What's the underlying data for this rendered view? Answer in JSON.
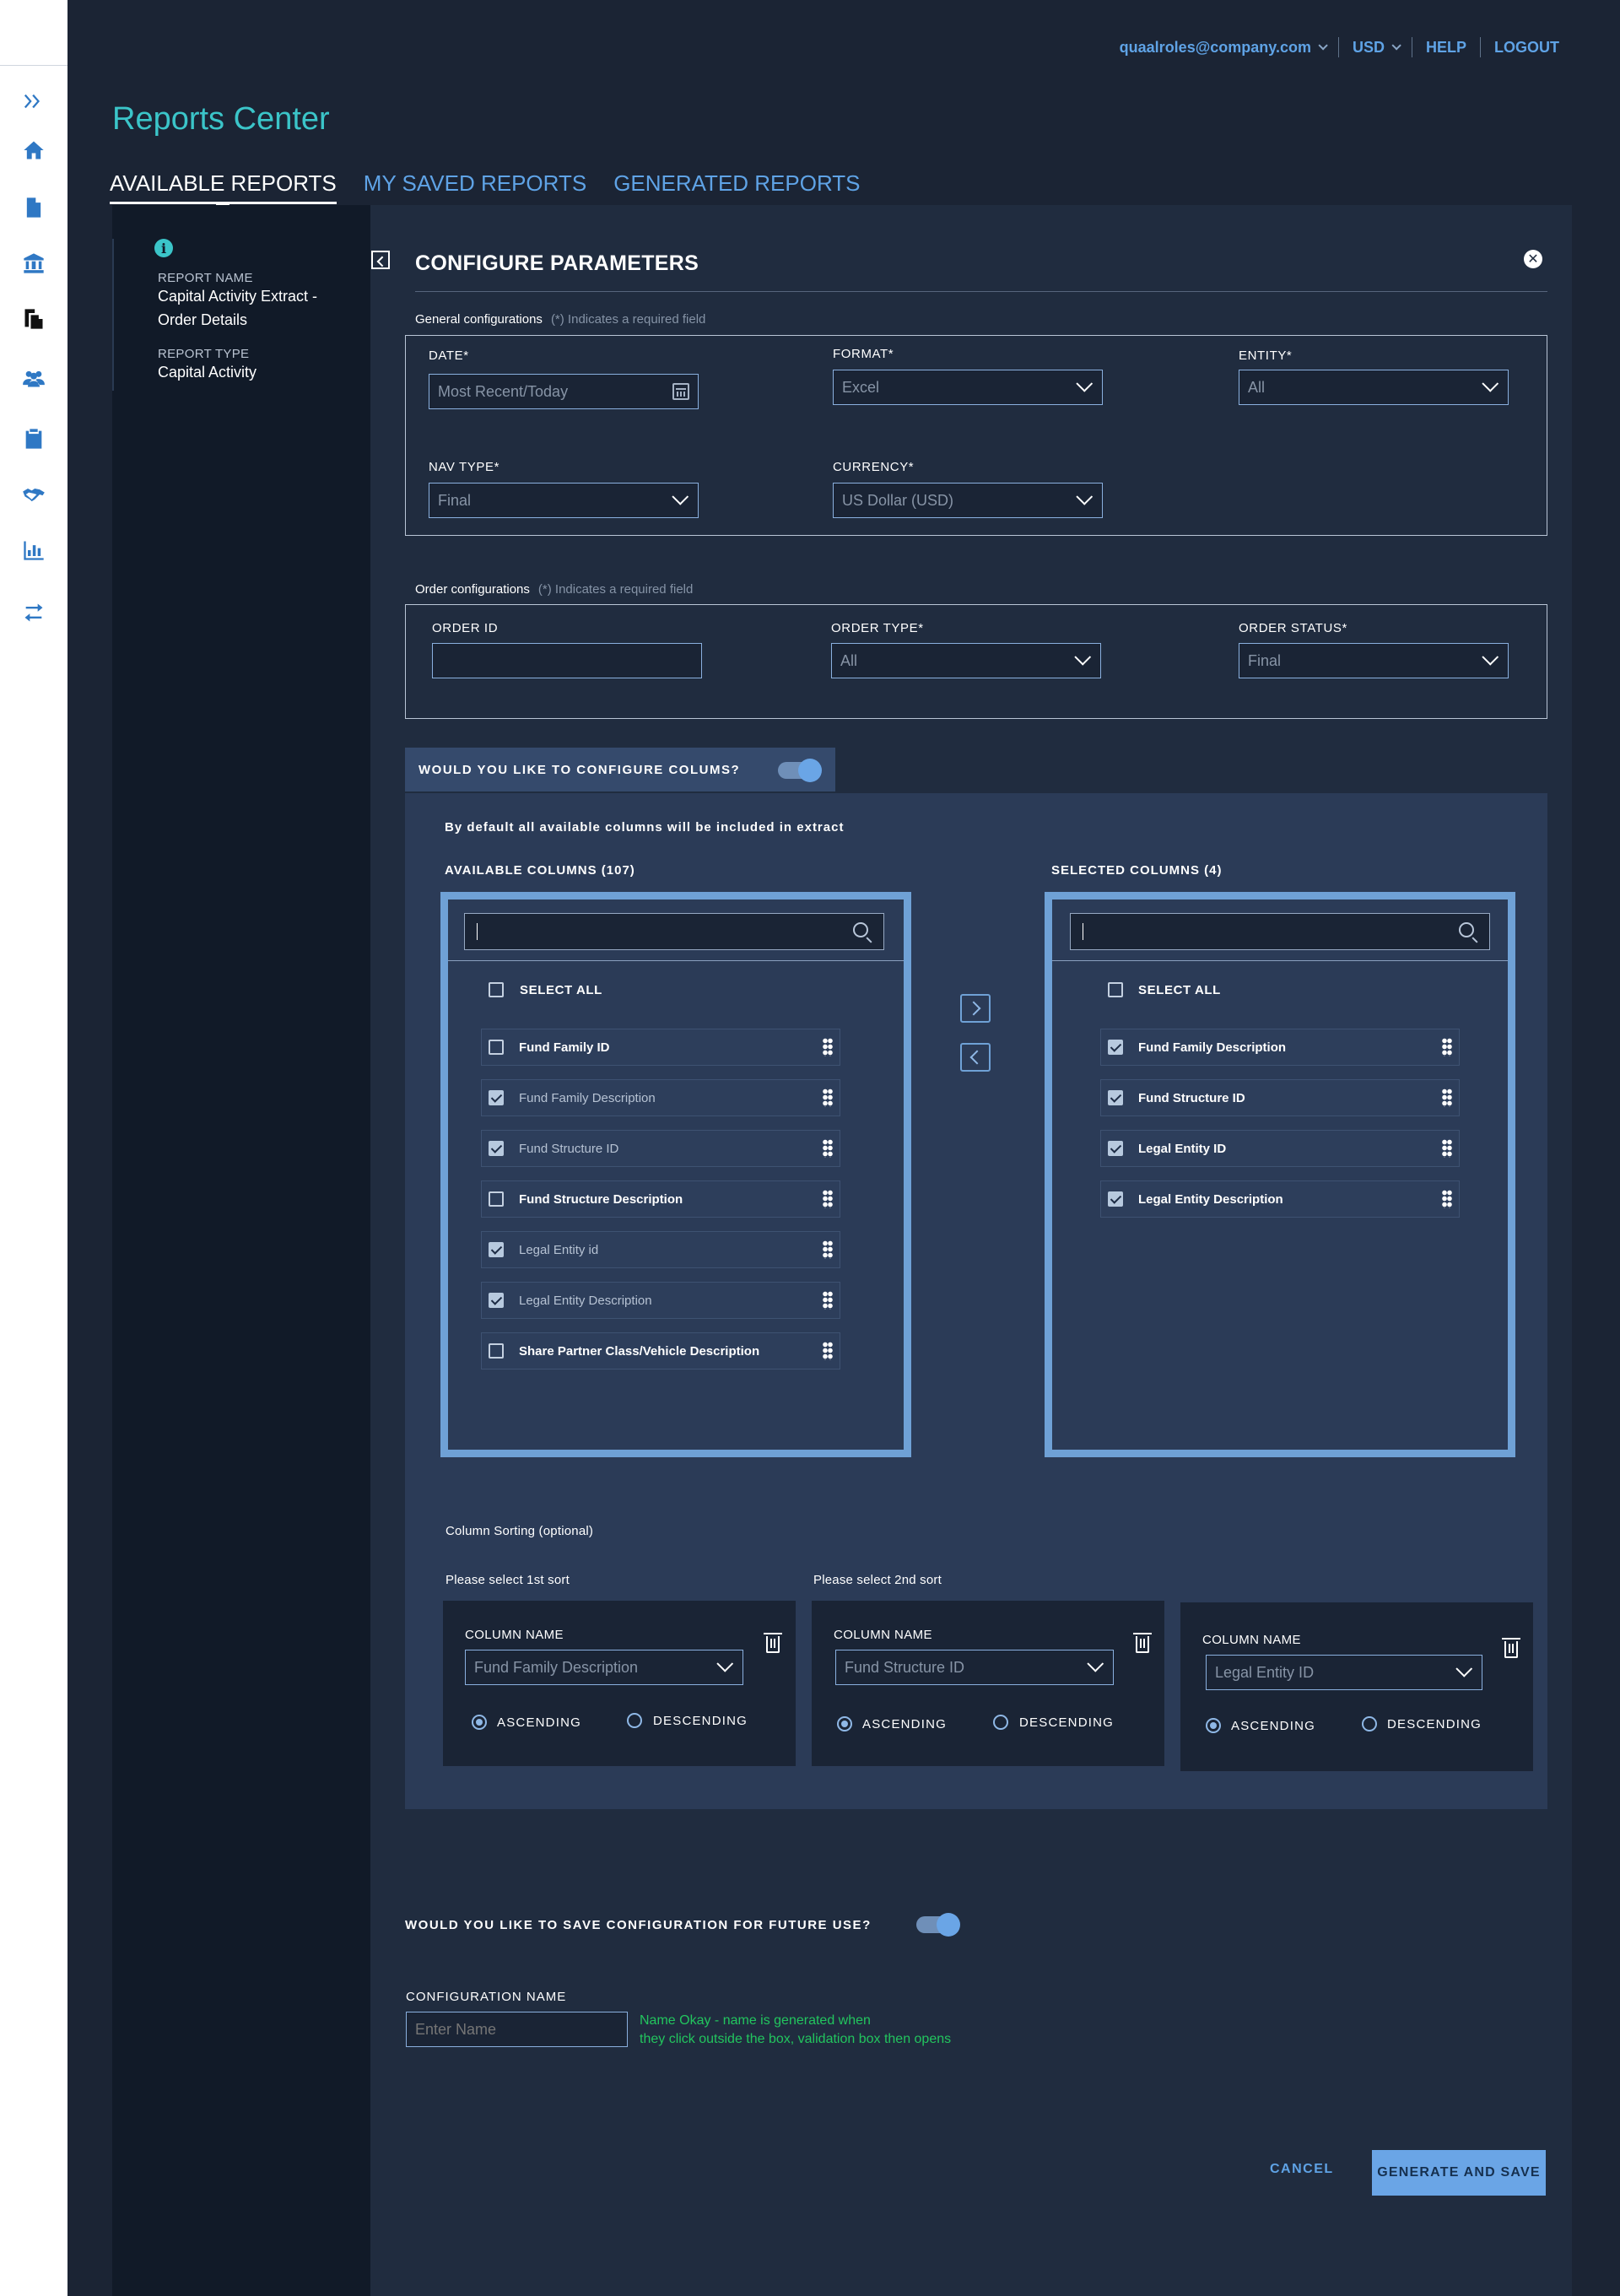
{
  "header": {
    "user": "quaalroles@company.com",
    "currency": "USD",
    "help": "HELP",
    "logout": "LOGOUT"
  },
  "page_title": "Reports Center",
  "tabs": [
    "AVAILABLE REPORTS",
    "MY SAVED REPORTS",
    "GENERATED REPORTS"
  ],
  "sidebar_icons": [
    "expand-icon",
    "home-icon",
    "document-icon",
    "bank-icon",
    "copy-documents-icon",
    "users-icon",
    "clipboard-icon",
    "handshake-icon",
    "bar-chart-icon",
    "transfer-icon"
  ],
  "report_info": {
    "name_label": "REPORT NAME",
    "name_value": "Capital Activity Extract - Order Details",
    "type_label": "REPORT TYPE",
    "type_value": "Capital Activity"
  },
  "configure": {
    "title": "CONFIGURE PARAMETERS",
    "general_label": "General configurations",
    "required_note": "(*) Indicates a required field",
    "date_label": "DATE*",
    "date_placeholder": "Most Recent/Today",
    "format_label": "FORMAT*",
    "format_value": "Excel",
    "entity_label": "ENTITY*",
    "entity_value": "All",
    "nav_label": "NAV TYPE*",
    "nav_value": "Final",
    "currency_label": "CURRENCY*",
    "currency_value": "US Dollar (USD)",
    "order_label": "Order configurations",
    "order_id_label": "ORDER ID",
    "order_id_value": "",
    "order_type_label": "ORDER TYPE*",
    "order_type_value": "All",
    "order_status_label": "ORDER STATUS*",
    "order_status_value": "Final"
  },
  "columns": {
    "question": "WOULD YOU LIKE TO CONFIGURE COLUMS?",
    "toggle_on": true,
    "default_note": "By default all available columns will be included in extract",
    "available_title": "AVAILABLE COLUMNS (107)",
    "selected_title": "SELECTED COLUMNS (4)",
    "search_value": "I",
    "select_all": "SELECT ALL",
    "available": [
      {
        "label": "Fund Family ID",
        "checked": false
      },
      {
        "label": "Fund Family Description",
        "checked": true
      },
      {
        "label": "Fund Structure ID",
        "checked": true
      },
      {
        "label": "Fund Structure Description",
        "checked": false
      },
      {
        "label": "Legal Entity id",
        "checked": true
      },
      {
        "label": "Legal Entity Description",
        "checked": true
      },
      {
        "label": "Share Partner Class/Vehicle Description",
        "checked": false
      }
    ],
    "selected": [
      {
        "label": "Fund Family Description",
        "checked": true
      },
      {
        "label": "Fund Structure ID",
        "checked": true
      },
      {
        "label": "Legal Entity ID",
        "checked": true
      },
      {
        "label": "Legal Entity Description",
        "checked": true
      }
    ]
  },
  "sorting": {
    "title": "Column Sorting (optional)",
    "first_label": "Please select 1st sort",
    "second_label": "Please select 2nd sort",
    "column_name_label": "COLUMN NAME",
    "ascending": "ASCENDING",
    "descending": "DESCENDING",
    "sorts": [
      {
        "value": "Fund Family Description",
        "order": "ascending"
      },
      {
        "value": "Fund Structure ID",
        "order": "ascending"
      },
      {
        "value": "Legal Entity ID",
        "order": "ascending"
      }
    ]
  },
  "save": {
    "question": "WOULD YOU LIKE TO SAVE CONFIGURATION FOR FUTURE USE?",
    "toggle_on": true,
    "config_name_label": "CONFIGURATION NAME",
    "config_name_placeholder": "Enter Name",
    "note_line1": "Name Okay - name is generated when",
    "note_line2": "they click outside the box, validation box then opens"
  },
  "actions": {
    "cancel": "CANCEL",
    "generate": "GENERATE AND SAVE"
  },
  "colors": {
    "accent": "#3bc5c9",
    "link": "#5fa3e6",
    "frame": "#6fa1d6",
    "note": "#22c55e"
  }
}
